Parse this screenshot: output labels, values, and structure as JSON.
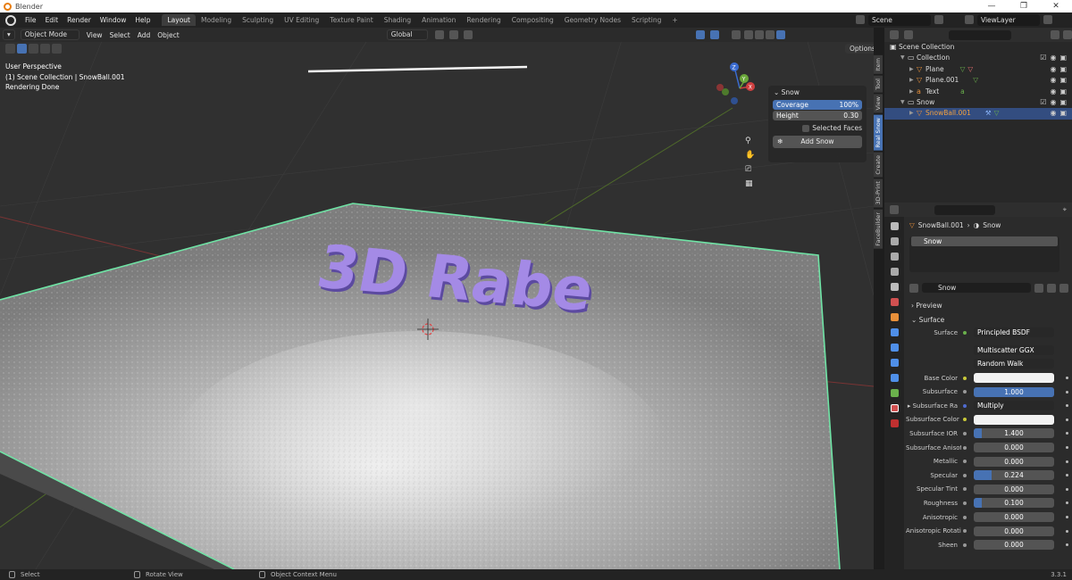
{
  "window": {
    "title": "Blender",
    "controls": [
      "—",
      "❐",
      "✕"
    ]
  },
  "menubar": {
    "items": [
      "File",
      "Edit",
      "Render",
      "Window",
      "Help"
    ],
    "workspaces": [
      "Layout",
      "Modeling",
      "Sculpting",
      "UV Editing",
      "Texture Paint",
      "Shading",
      "Animation",
      "Rendering",
      "Compositing",
      "Geometry Nodes",
      "Scripting"
    ],
    "active_workspace": "Layout",
    "add_tab": "+",
    "scene": "Scene",
    "view_layer": "ViewLayer"
  },
  "viewport": {
    "mode": "Object Mode",
    "menus": [
      "View",
      "Select",
      "Add",
      "Object"
    ],
    "orientation": "Global",
    "options_label": "Options",
    "overlay_lines": [
      "User Perspective",
      "(1) Scene Collection | SnowBall.001",
      "Rendering Done"
    ],
    "scene_text": "3D Rabe",
    "text_color": "#9a7fe0",
    "selection_outline_color": "#6fe3a5",
    "gizmo_axes": [
      "X",
      "Y",
      "Z"
    ],
    "tool_icons": [
      "zoom-icon",
      "hand-icon",
      "camera-icon",
      "grid-icon"
    ]
  },
  "snow_panel": {
    "title": "Snow",
    "coverage_label": "Coverage",
    "coverage_value": "100%",
    "height_label": "Height",
    "height_value": "0.30",
    "selected_faces_label": "Selected Faces",
    "add_snow_label": "Add Snow"
  },
  "sidebar_tabs": [
    "Item",
    "Tool",
    "View",
    "Real Snow",
    "Create",
    "3D-Print",
    "FaceBuilder"
  ],
  "sidebar_active_tab": "Real Snow",
  "outliner": {
    "root": "Scene Collection",
    "rows": [
      {
        "name": "Collection",
        "indent": 1
      },
      {
        "name": "Plane",
        "indent": 2
      },
      {
        "name": "Plane.001",
        "indent": 2
      },
      {
        "name": "Text",
        "indent": 2
      },
      {
        "name": "Snow",
        "indent": 1
      },
      {
        "name": "SnowBall.001",
        "indent": 2,
        "selected": true
      }
    ]
  },
  "properties": {
    "breadcrumb_object": "SnowBall.001",
    "breadcrumb_material": "Snow",
    "slot_name": "Snow",
    "material_name": "Snow",
    "preview_label": "Preview",
    "surface_section": "Surface",
    "surface_label": "Surface",
    "surface_shader": "Principled BSDF",
    "distribution": "Multiscatter GGX",
    "subsurface_method": "Random Walk",
    "rows": [
      {
        "label": "Base Color",
        "value": "",
        "kind": "color",
        "fill": 0
      },
      {
        "label": "Subsurface",
        "value": "1.000",
        "kind": "slider",
        "fill": 1.0
      },
      {
        "label": "Subsurface Ra",
        "value": "Multiply",
        "kind": "dark",
        "fill": 0
      },
      {
        "label": "Subsurface Color",
        "value": "",
        "kind": "color",
        "fill": 0
      },
      {
        "label": "Subsurface IOR",
        "value": "1.400",
        "kind": "slider",
        "fill": 0.1
      },
      {
        "label": "Subsurface Anisot...",
        "value": "0.000",
        "kind": "slider",
        "fill": 0
      },
      {
        "label": "Metallic",
        "value": "0.000",
        "kind": "slider",
        "fill": 0
      },
      {
        "label": "Specular",
        "value": "0.224",
        "kind": "slider",
        "fill": 0.224
      },
      {
        "label": "Specular Tint",
        "value": "0.000",
        "kind": "slider",
        "fill": 0
      },
      {
        "label": "Roughness",
        "value": "0.100",
        "kind": "slider",
        "fill": 0.1
      },
      {
        "label": "Anisotropic",
        "value": "0.000",
        "kind": "slider",
        "fill": 0
      },
      {
        "label": "Anisotropic Rotati...",
        "value": "0.000",
        "kind": "slider",
        "fill": 0
      },
      {
        "label": "Sheen",
        "value": "0.000",
        "kind": "slider",
        "fill": 0
      }
    ]
  },
  "statusbar": {
    "items": [
      "Select",
      "Rotate View",
      "Object Context Menu"
    ],
    "version": "3.3.1"
  }
}
